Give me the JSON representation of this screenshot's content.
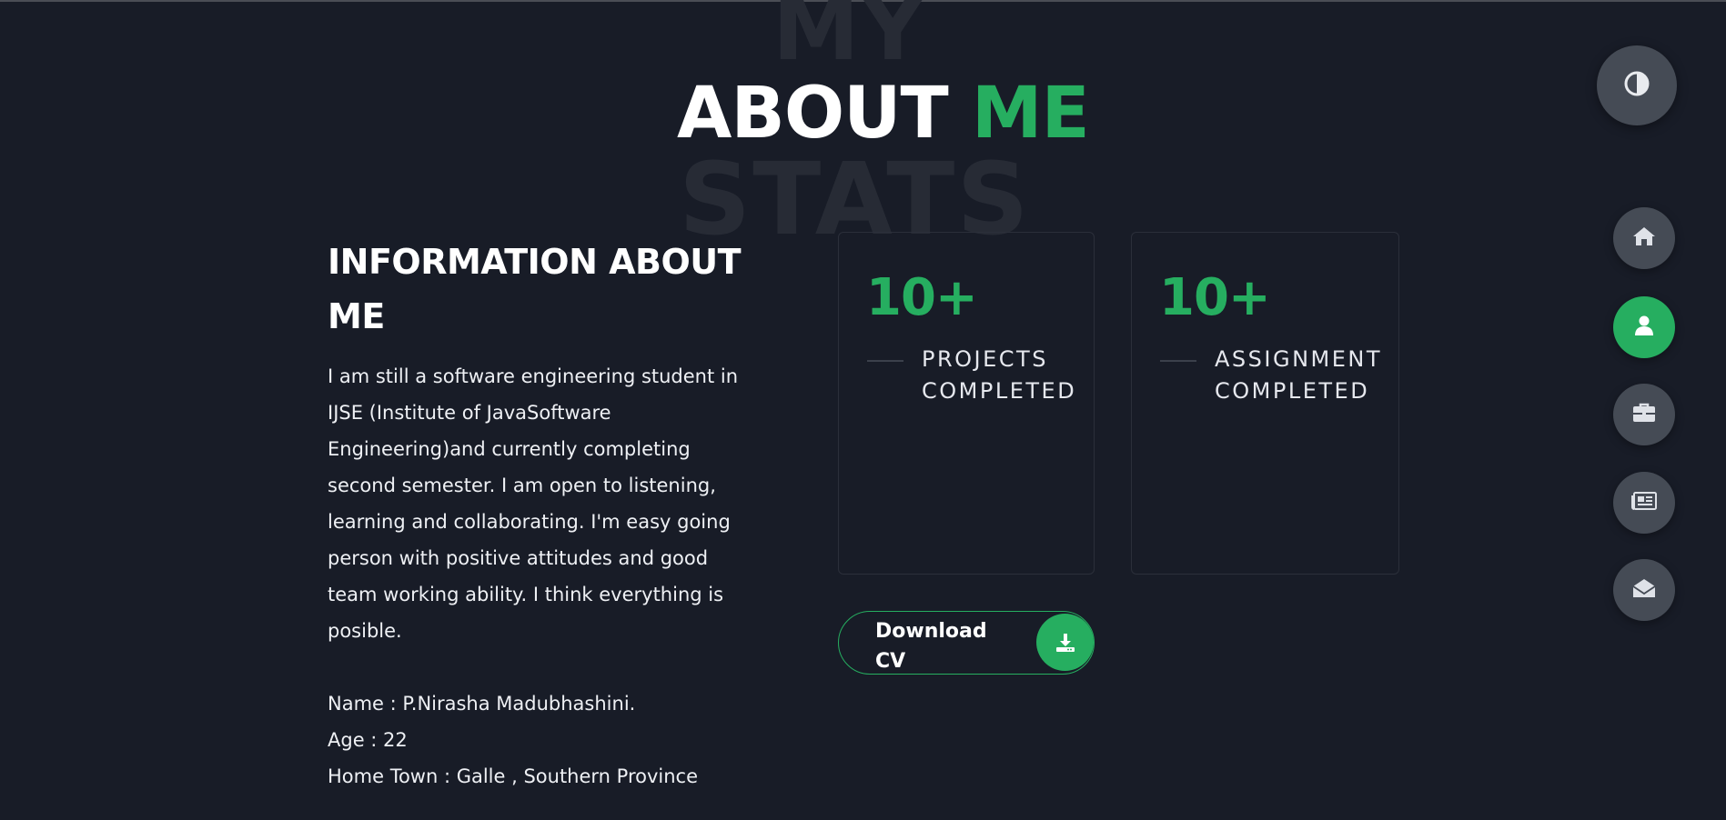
{
  "section": {
    "bg_word_top": "MY",
    "bg_word_bottom": "STATS",
    "title_main": "ABOUT ",
    "title_accent": "ME"
  },
  "info": {
    "heading": "INFORMATION ABOUT ME",
    "paragraph": "I am still a software engineering student in IJSE (Institute of JavaSoftware Engineering)and currently completing second semester. I am open to listening, learning and collaborating. I'm easy going person with positive attitudes and good team working ability. I think everything is posible.",
    "details": [
      "Name : P.Nirasha Madubhashini.",
      "Age : 22",
      "Home Town : Galle , Southern Province"
    ]
  },
  "stats": [
    {
      "number": "10+",
      "label": "PROJECTS COMPLETED"
    },
    {
      "number": "10+",
      "label": "ASSIGNMENT COMPLETED"
    }
  ],
  "download": {
    "label": "Download CV",
    "icon": "download-icon"
  },
  "controls": {
    "theme_toggle_icon": "contrast-icon",
    "nav": [
      {
        "name": "home",
        "icon": "home-icon",
        "active": false
      },
      {
        "name": "about",
        "icon": "user-icon",
        "active": true
      },
      {
        "name": "portfolio",
        "icon": "briefcase-icon",
        "active": false
      },
      {
        "name": "blog",
        "icon": "newspaper-icon",
        "active": false
      },
      {
        "name": "contact",
        "icon": "envelope-open-icon",
        "active": false
      }
    ]
  },
  "colors": {
    "background": "#181c27",
    "accent": "#26ae60",
    "button_gray": "#454b55",
    "watermark": "#272b35"
  }
}
